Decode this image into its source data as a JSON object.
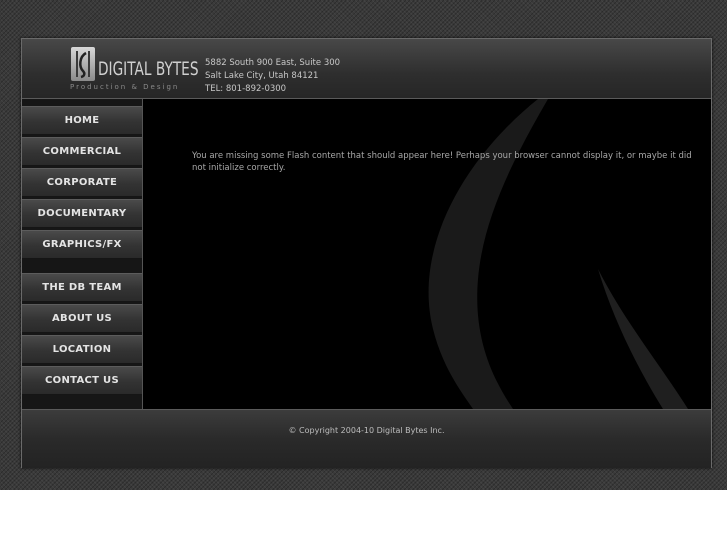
{
  "brand": {
    "name": "DIGITAL BYTES",
    "tagline": "Production & Design"
  },
  "address": {
    "line1": "5882 South 900 East, Suite 300",
    "line2": "Salt Lake City, Utah 84121",
    "phone": "TEL: 801-892-0300"
  },
  "nav": {
    "items": [
      {
        "label": "HOME"
      },
      {
        "label": "COMMERCIAL"
      },
      {
        "label": "CORPORATE"
      },
      {
        "label": "DOCUMENTARY"
      },
      {
        "label": "GRAPHICS/FX"
      },
      {
        "label": "THE DB TEAM"
      },
      {
        "label": "ABOUT US"
      },
      {
        "label": "LOCATION"
      },
      {
        "label": "CONTACT US"
      }
    ]
  },
  "main": {
    "flash_message": "You are missing some Flash content that should appear here! Perhaps your browser cannot display it, or maybe it did not initialize correctly."
  },
  "footer": {
    "copyright": "© Copyright 2004-10 Digital Bytes Inc."
  },
  "colors": {
    "frame_bg": "#1c1c1c",
    "content_bg": "#000000",
    "nav_text": "#e4e4e4"
  }
}
